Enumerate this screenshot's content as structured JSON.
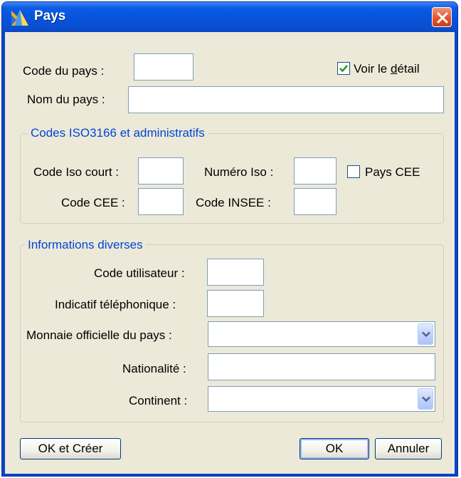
{
  "window": {
    "title": "Pays"
  },
  "top": {
    "code_label": "Code du pays :",
    "nom_label": "Nom du pays :",
    "voir_detail_prefix": "Voir le ",
    "voir_detail_underlined": "d",
    "voir_detail_suffix": "étail",
    "voir_detail_checked": true,
    "code_value": "",
    "nom_value": ""
  },
  "iso_group": {
    "title": "Codes ISO3166 et administratifs",
    "code_iso_court_label": "Code Iso court :",
    "numero_iso_label": "Numéro Iso :",
    "pays_cee_label": "Pays CEE",
    "pays_cee_checked": false,
    "code_cee_label": "Code CEE :",
    "code_insee_label": "Code INSEE :"
  },
  "info_group": {
    "title": "Informations diverses",
    "code_utilisateur_label": "Code utilisateur :",
    "indicatif_label": "Indicatif téléphonique :",
    "monnaie_label": "Monnaie officielle du pays :",
    "monnaie_value": "",
    "nationalite_label": "Nationalité :",
    "continent_label": "Continent :",
    "continent_value": ""
  },
  "buttons": {
    "ok_creer": "OK et Créer",
    "ok": "OK",
    "annuler": "Annuler"
  },
  "colors": {
    "titlebar": "#0a5ce6",
    "client": "#ece9d8",
    "group_title": "#0046d5",
    "close": "#e3552e"
  }
}
